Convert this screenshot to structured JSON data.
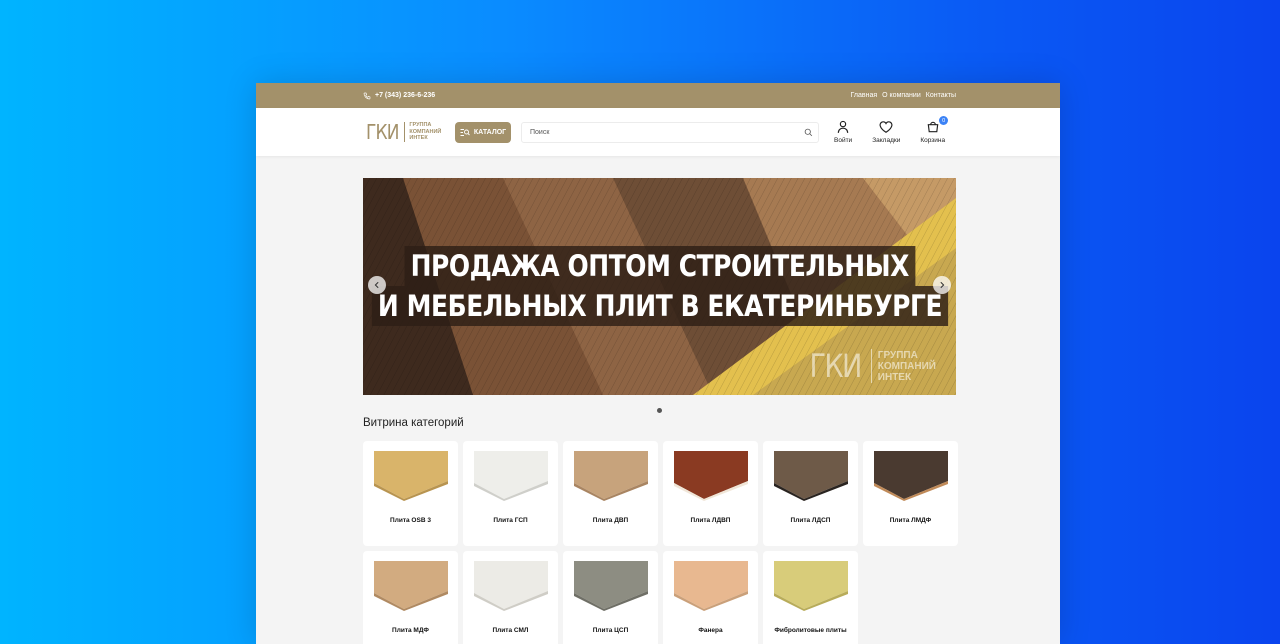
{
  "topbar": {
    "phone": "+7 (343) 236-6-236",
    "links": [
      "Главная",
      "О компании",
      "Контакты"
    ]
  },
  "header": {
    "logo_mark": "ГКИ",
    "logo_words": [
      "ГРУППА",
      "КОМПАНИЙ",
      "ИНТЕК"
    ],
    "catalog_label": "КАТАЛОГ",
    "search_placeholder": "Поиск",
    "actions": [
      {
        "label": "Войти",
        "icon": "user-icon"
      },
      {
        "label": "Закладки",
        "icon": "heart-icon"
      },
      {
        "label": "Корзина",
        "icon": "cart-icon",
        "badge": "0"
      }
    ]
  },
  "banner": {
    "headline_line1": "ПРОДАЖА ОПТОМ СТРОИТЕЛЬНЫХ",
    "headline_line2": "И МЕБЕЛЬНЫХ ПЛИТ В ЕКАТЕРИНБУРГЕ",
    "watermark_mark": "ГКИ",
    "watermark_words": [
      "ГРУППА",
      "КОМПАНИЙ",
      "ИНТЕК"
    ]
  },
  "section_title": "Витрина категорий",
  "colors": {
    "brand": "#a3916a",
    "badge": "#3b82f6"
  },
  "categories": [
    {
      "label": "Плита OSB 3",
      "top": "#d9b46a",
      "edge": "#b89450"
    },
    {
      "label": "Плита ГСП",
      "top": "#eeeeea",
      "edge": "#cfcfca"
    },
    {
      "label": "Плита ДВП",
      "top": "#c7a37c",
      "edge": "#a98562"
    },
    {
      "label": "Плита ЛДВП",
      "top": "#8a3a22",
      "edge": "#f0e6d8"
    },
    {
      "label": "Плита ЛДСП",
      "top": "#6e5a48",
      "edge": "#2a2420"
    },
    {
      "label": "Плита ЛМДФ",
      "top": "#4a3a30",
      "edge": "#c08a58"
    },
    {
      "label": "Плита МДФ",
      "top": "#d2ab80",
      "edge": "#b08a62"
    },
    {
      "label": "Плита СМЛ",
      "top": "#ecebe6",
      "edge": "#cfcdc6"
    },
    {
      "label": "Плита ЦСП",
      "top": "#8d8d82",
      "edge": "#6f6f66"
    },
    {
      "label": "Фанера",
      "top": "#e8b890",
      "edge": "#caa07a"
    },
    {
      "label": "Фибролитовые плиты",
      "top": "#d8cc7a",
      "edge": "#b8ac5a"
    }
  ]
}
